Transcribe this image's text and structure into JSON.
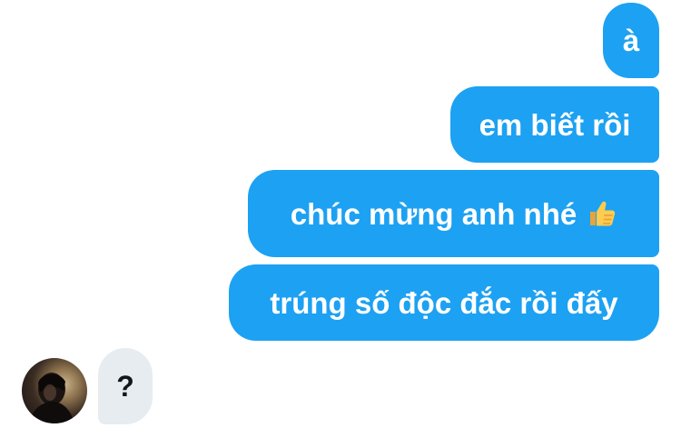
{
  "conversation": {
    "sent_messages": [
      "à",
      "em biết rồi",
      "chúc mừng anh nhé",
      "trúng số độc đắc rồi đấy"
    ],
    "received_messages": [
      "?"
    ],
    "emoji": {
      "icon": "thumbs-up-icon"
    },
    "colors": {
      "sent_bubble": "#1da1f2",
      "received_bubble": "#e6ecf0",
      "sent_text": "#ffffff",
      "received_text": "#14171a"
    }
  }
}
